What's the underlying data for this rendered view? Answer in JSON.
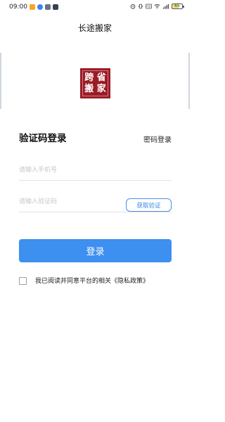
{
  "status_bar": {
    "time": "09:00",
    "battery_level_percent": "65",
    "icons_left": [
      "app-notify-orange",
      "app-notify-blue",
      "app-notify-gray",
      "app-notify-dark"
    ],
    "icons_right": [
      "alarm-icon",
      "vibrate-icon",
      "hd-icon",
      "wifi-icon",
      "signal-icon",
      "battery-icon"
    ]
  },
  "header": {
    "title": "长途搬家"
  },
  "logo": {
    "chars": [
      "跨",
      "省",
      "搬",
      "家"
    ],
    "bg_color": "#9b1b25"
  },
  "login": {
    "title": "验证码登录",
    "switch_mode_label": "密码登录",
    "phone_placeholder": "请输入手机号",
    "code_placeholder": "请输入验证码",
    "get_code_label": "获取验证",
    "submit_label": "登录",
    "agreement_text": "我已阅读并同意平台的相关《隐私政策》",
    "accent_color": "#3d8ff0"
  }
}
